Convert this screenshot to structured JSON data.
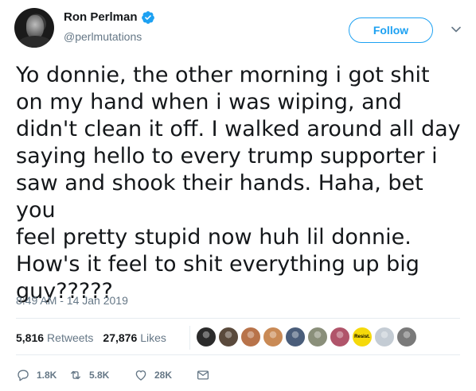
{
  "user": {
    "display_name": "Ron Perlman",
    "handle": "@perlmutations",
    "verified": true
  },
  "follow_label": "Follow",
  "tweet": {
    "text": "Yo donnie, the other morning i got shit\non my hand when i was wiping, and\ndidn't clean it off. I walked around all day\nsaying hello to every trump supporter i\nsaw and shook their hands. Haha, bet you\nfeel pretty stupid now huh lil donnie.\nHow's it feel to shit everything up big\nguy?????",
    "timestamp": "8:49 AM - 14 Jan 2019"
  },
  "stats": {
    "retweets_count": "5,816",
    "retweets_label": "Retweets",
    "likes_count": "27,876",
    "likes_label": "Likes"
  },
  "likers": [
    {
      "name": "liker-1",
      "color": "#2b2b2b"
    },
    {
      "name": "liker-2",
      "color": "#5a4a3c"
    },
    {
      "name": "liker-3",
      "color": "#b8734a"
    },
    {
      "name": "liker-4",
      "color": "#c98a55"
    },
    {
      "name": "liker-5",
      "color": "#4a5d7a"
    },
    {
      "name": "liker-6",
      "color": "#8a8f7a"
    },
    {
      "name": "liker-7",
      "color": "#b0546a"
    },
    {
      "name": "liker-8",
      "color": "#f5d90a",
      "text": "Resist."
    },
    {
      "name": "liker-9",
      "color": "#c4ccd4"
    },
    {
      "name": "liker-10",
      "color": "#7a7a7a"
    }
  ],
  "actions": {
    "reply_count": "1.8K",
    "retweet_count": "5.8K",
    "like_count": "28K"
  },
  "colors": {
    "accent": "#1da1f2",
    "text": "#14171a",
    "secondary": "#657786"
  }
}
